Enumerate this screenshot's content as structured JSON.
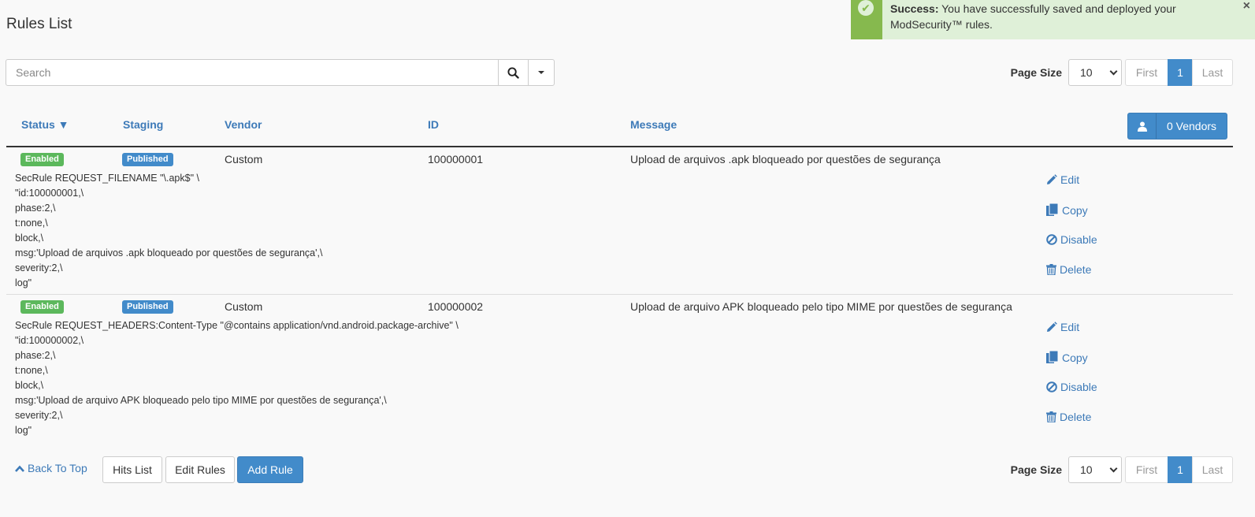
{
  "page_title": "Rules List",
  "alert": {
    "strong": "Success:",
    "text": " You have successfully saved and deployed your ModSecurity™ rules.",
    "close": "×"
  },
  "search": {
    "placeholder": "Search",
    "value": ""
  },
  "pager": {
    "page_size_label": "Page Size",
    "page_size": "10",
    "first": "First",
    "current": "1",
    "last": "Last"
  },
  "table": {
    "headers": {
      "status": "Status ▼",
      "staging": "Staging",
      "vendor": "Vendor",
      "id": "ID",
      "message": "Message"
    },
    "vendors_button": "0 Vendors",
    "rows": [
      {
        "status": "Enabled",
        "staging": "Published",
        "vendor": "Custom",
        "id": "100000001",
        "message": "Upload de arquivos .apk bloqueado por questões de segurança",
        "code": "SecRule REQUEST_FILENAME \"\\.apk$\" \\\n\"id:100000001,\\\nphase:2,\\\nt:none,\\\nblock,\\\nmsg:'Upload de arquivos .apk bloqueado por questões de segurança',\\\nseverity:2,\\\nlog\""
      },
      {
        "status": "Enabled",
        "staging": "Published",
        "vendor": "Custom",
        "id": "100000002",
        "message": "Upload de arquivo APK bloqueado pelo tipo MIME por questões de segurança",
        "code": "SecRule REQUEST_HEADERS:Content-Type \"@contains application/vnd.android.package-archive\" \\\n\"id:100000002,\\\nphase:2,\\\nt:none,\\\nblock,\\\nmsg:'Upload de arquivo APK bloqueado pelo tipo MIME por questões de segurança',\\\nseverity:2,\\\nlog\""
      }
    ],
    "actions": {
      "edit": "Edit",
      "copy": "Copy",
      "disable": "Disable",
      "delete": "Delete"
    }
  },
  "footer": {
    "back_to_top": "Back To Top",
    "hits_list": "Hits List",
    "edit_rules": "Edit Rules",
    "add_rule": "Add Rule"
  },
  "colors": {
    "primary": "#428bca",
    "success": "#5cb85c",
    "link": "#3d7ab8",
    "alert_bg": "#dff0d8",
    "alert_accent": "#86b94e"
  }
}
